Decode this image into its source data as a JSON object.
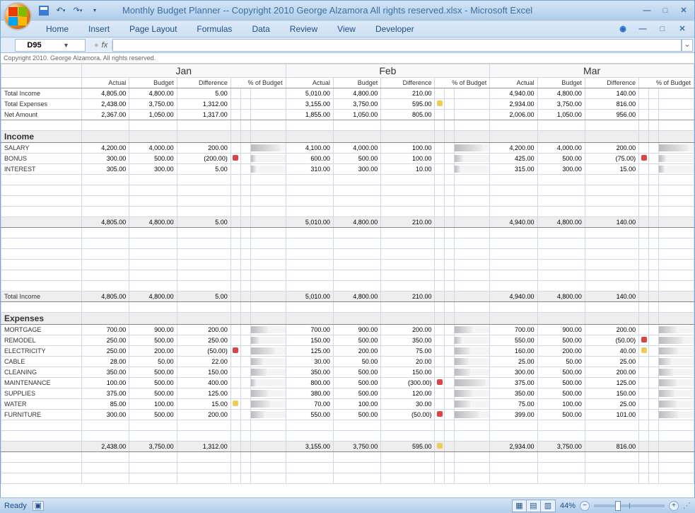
{
  "title": "Monthly Budget Planner -- Copyright 2010 George Alzamora  All rights reserved.xlsx - Microsoft Excel",
  "ribbon_tabs": [
    "Home",
    "Insert",
    "Page Layout",
    "Formulas",
    "Data",
    "Review",
    "View",
    "Developer"
  ],
  "name_box": "D95",
  "copyright": "Copyright 2010.  George Alzamora.  All rights reserved.",
  "months": [
    "Jan",
    "Feb",
    "Mar"
  ],
  "col_headers": [
    "Actual",
    "Budget",
    "Difference",
    "% of Budget"
  ],
  "summary_labels": [
    "Total Income",
    "Total Expenses",
    "Net Amount"
  ],
  "summary": {
    "Jan": [
      [
        "4,805.00",
        "4,800.00",
        "5.00",
        ""
      ],
      [
        "2,438.00",
        "3,750.00",
        "1,312.00",
        ""
      ],
      [
        "2,367.00",
        "1,050.00",
        "1,317.00",
        ""
      ]
    ],
    "Feb": [
      [
        "5,010.00",
        "4,800.00",
        "210.00",
        ""
      ],
      [
        "3,155.00",
        "3,750.00",
        "595.00",
        "y"
      ],
      [
        "1,855.00",
        "1,050.00",
        "805.00",
        ""
      ]
    ],
    "Mar": [
      [
        "4,940.00",
        "4,800.00",
        "140.00",
        ""
      ],
      [
        "2,934.00",
        "3,750.00",
        "816.00",
        ""
      ],
      [
        "2,006.00",
        "1,050.00",
        "956.00",
        ""
      ]
    ]
  },
  "income_header": "Income",
  "income_labels": [
    "SALARY",
    "BONUS",
    "INTEREST"
  ],
  "income": {
    "Jan": [
      [
        "4,200.00",
        "4,000.00",
        "200.00",
        "",
        85
      ],
      [
        "300.00",
        "500.00",
        "(200.00)",
        "r",
        15
      ],
      [
        "305.00",
        "300.00",
        "5.00",
        "",
        16
      ]
    ],
    "Feb": [
      [
        "4,100.00",
        "4,000.00",
        "100.00",
        "",
        82
      ],
      [
        "600.00",
        "500.00",
        "100.00",
        "",
        25
      ],
      [
        "310.00",
        "300.00",
        "10.00",
        "",
        16
      ]
    ],
    "Mar": [
      [
        "4,200.00",
        "4,000.00",
        "200.00",
        "",
        85
      ],
      [
        "425.00",
        "500.00",
        "(75.00)",
        "r",
        20
      ],
      [
        "315.00",
        "300.00",
        "15.00",
        "",
        16
      ]
    ]
  },
  "income_subtotal": {
    "Jan": [
      "4,805.00",
      "4,800.00",
      "5.00"
    ],
    "Feb": [
      "5,010.00",
      "4,800.00",
      "210.00"
    ],
    "Mar": [
      "4,940.00",
      "4,800.00",
      "140.00"
    ]
  },
  "total_income_label": "Total Income",
  "total_income": {
    "Jan": [
      "4,805.00",
      "4,800.00",
      "5.00"
    ],
    "Feb": [
      "5,010.00",
      "4,800.00",
      "210.00"
    ],
    "Mar": [
      "4,940.00",
      "4,800.00",
      "140.00"
    ]
  },
  "expenses_header": "Expenses",
  "expense_labels": [
    "MORTGAGE",
    "REMODEL",
    "ELECTRICITY",
    "CABLE",
    "CLEANING",
    "MAINTENANCE",
    "SUPPLIES",
    "WATER",
    "FURNITURE"
  ],
  "expenses": {
    "Jan": [
      [
        "700.00",
        "900.00",
        "200.00",
        "",
        50
      ],
      [
        "250.00",
        "500.00",
        "250.00",
        "",
        25
      ],
      [
        "250.00",
        "200.00",
        "(50.00)",
        "r",
        70
      ],
      [
        "28.00",
        "50.00",
        "22.00",
        "",
        35
      ],
      [
        "350.00",
        "500.00",
        "150.00",
        "",
        45
      ],
      [
        "100.00",
        "500.00",
        "400.00",
        "",
        15
      ],
      [
        "375.00",
        "500.00",
        "125.00",
        "",
        50
      ],
      [
        "85.00",
        "100.00",
        "15.00",
        "y",
        55
      ],
      [
        "300.00",
        "500.00",
        "200.00",
        "",
        40
      ]
    ],
    "Feb": [
      [
        "700.00",
        "900.00",
        "200.00",
        "",
        50
      ],
      [
        "150.00",
        "500.00",
        "350.00",
        "",
        20
      ],
      [
        "125.00",
        "200.00",
        "75.00",
        "",
        45
      ],
      [
        "30.00",
        "50.00",
        "20.00",
        "",
        40
      ],
      [
        "350.00",
        "500.00",
        "150.00",
        "",
        45
      ],
      [
        "800.00",
        "500.00",
        "(300.00)",
        "r",
        90
      ],
      [
        "380.00",
        "500.00",
        "120.00",
        "",
        50
      ],
      [
        "70.00",
        "100.00",
        "30.00",
        "",
        45
      ],
      [
        "550.00",
        "500.00",
        "(50.00)",
        "r",
        70
      ]
    ],
    "Mar": [
      [
        "700.00",
        "900.00",
        "200.00",
        "",
        50
      ],
      [
        "550.00",
        "500.00",
        "(50.00)",
        "r",
        70
      ],
      [
        "160.00",
        "200.00",
        "40.00",
        "y",
        55
      ],
      [
        "25.00",
        "50.00",
        "25.00",
        "",
        35
      ],
      [
        "300.00",
        "500.00",
        "200.00",
        "",
        40
      ],
      [
        "375.00",
        "500.00",
        "125.00",
        "",
        50
      ],
      [
        "350.00",
        "500.00",
        "150.00",
        "",
        45
      ],
      [
        "75.00",
        "100.00",
        "25.00",
        "",
        50
      ],
      [
        "399.00",
        "500.00",
        "101.00",
        "",
        55
      ]
    ]
  },
  "expense_subtotal": {
    "Jan": [
      "2,438.00",
      "3,750.00",
      "1,312.00",
      ""
    ],
    "Feb": [
      "3,155.00",
      "3,750.00",
      "595.00",
      "y"
    ],
    "Mar": [
      "2,934.00",
      "3,750.00",
      "816.00",
      ""
    ]
  },
  "status": {
    "ready": "Ready",
    "zoom": "44%"
  }
}
